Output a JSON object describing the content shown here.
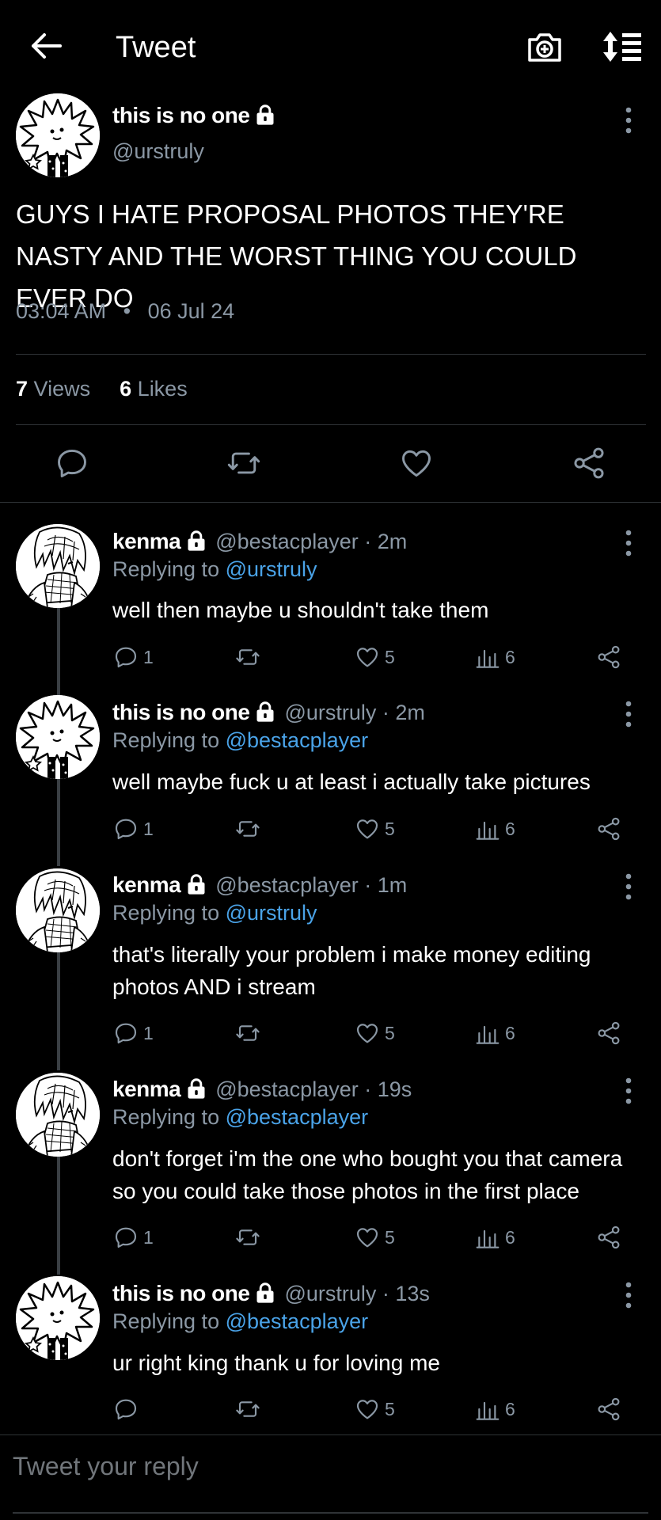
{
  "header": {
    "title": "Tweet"
  },
  "main_tweet": {
    "name": "this is no one",
    "handle": "@urstruly",
    "text": "GUYS I HATE PROPOSAL PHOTOS THEY'RE NASTY AND THE WORST THING YOU COULD EVER DO",
    "time": "03:04 AM",
    "separator": "•",
    "date": "06 Jul 24",
    "views_count": "7",
    "views_label": "Views",
    "likes_count": "6",
    "likes_label": "Likes"
  },
  "replies": [
    {
      "name": "kenma",
      "handle": "@bestacplayer · 2m",
      "replying_prefix": "Replying to",
      "replying_to": "@urstruly",
      "text": "well then maybe u shouldn't take them",
      "comments": "1",
      "likes": "5",
      "views": "6"
    },
    {
      "name": "this is no one",
      "handle": "@urstruly · 2m",
      "replying_prefix": "Replying to",
      "replying_to": "@bestacplayer",
      "text": "well maybe fuck u at least i actually take pictures",
      "comments": "1",
      "likes": "5",
      "views": "6"
    },
    {
      "name": "kenma",
      "handle": "@bestacplayer · 1m",
      "replying_prefix": "Replying to",
      "replying_to": "@urstruly",
      "text": "that's literally your problem i make money editing photos AND i stream",
      "comments": "1",
      "likes": "5",
      "views": "6"
    },
    {
      "name": "kenma",
      "handle": "@bestacplayer · 19s",
      "replying_prefix": "Replying to",
      "replying_to": "@bestacplayer",
      "text": "don't forget i'm the one who bought you that camera so you could take those photos in the first place",
      "comments": "1",
      "likes": "5",
      "views": "6"
    },
    {
      "name": "this is no one",
      "handle": "@urstruly · 13s",
      "replying_prefix": "Replying to",
      "replying_to": "@bestacplayer",
      "text": "ur right king thank u for loving me",
      "comments": "",
      "likes": "5",
      "views": "6"
    }
  ],
  "composer": {
    "placeholder": "Tweet your reply"
  },
  "colors": {
    "background": "#000000",
    "text": "#ffffff",
    "muted": "#8b98a5",
    "link": "#4aa3e8",
    "divider": "#2f3336"
  },
  "icons": [
    "back-arrow-icon",
    "camera-add-icon",
    "sort-icon",
    "lock-icon",
    "more-vertical-icon",
    "comment-icon",
    "retweet-icon",
    "heart-icon",
    "share-icon",
    "views-chart-icon"
  ]
}
